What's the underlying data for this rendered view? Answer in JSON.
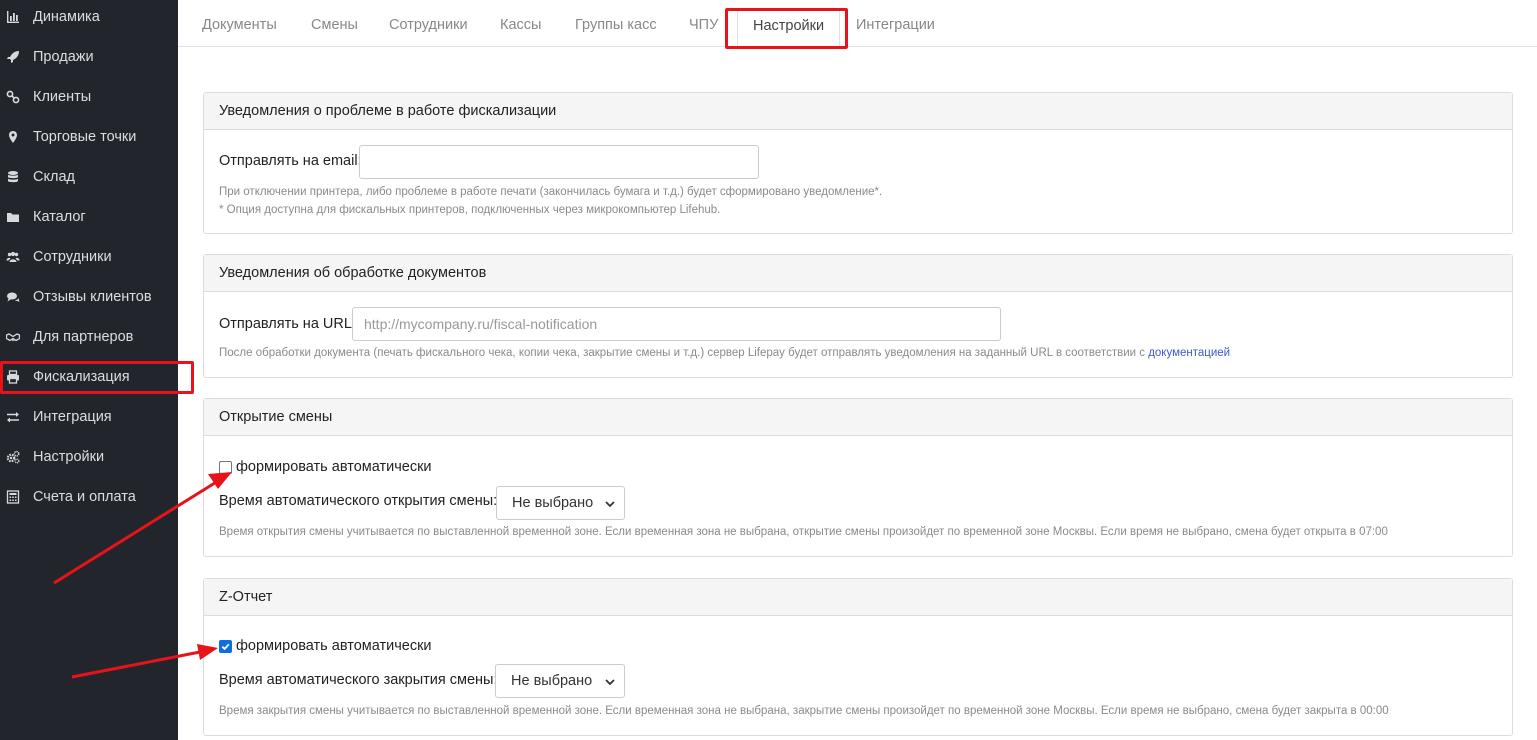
{
  "sidebar": {
    "items": [
      {
        "label": "Динамика",
        "icon": "bar-chart-icon"
      },
      {
        "label": "Продажи",
        "icon": "rocket-icon"
      },
      {
        "label": "Клиенты",
        "icon": "link-icon"
      },
      {
        "label": "Торговые точки",
        "icon": "map-pin-icon"
      },
      {
        "label": "Склад",
        "icon": "database-icon"
      },
      {
        "label": "Каталог",
        "icon": "folder-icon"
      },
      {
        "label": "Сотрудники",
        "icon": "users-icon"
      },
      {
        "label": "Отзывы клиентов",
        "icon": "comments-icon"
      },
      {
        "label": "Для партнеров",
        "icon": "handshake-icon"
      },
      {
        "label": "Фискализация",
        "icon": "printer-icon"
      },
      {
        "label": "Интеграция",
        "icon": "exchange-icon"
      },
      {
        "label": "Настройки",
        "icon": "gears-icon"
      },
      {
        "label": "Счета и оплата",
        "icon": "calculator-icon"
      }
    ],
    "active": "Фискализация"
  },
  "tabs": [
    "Документы",
    "Смены",
    "Сотрудники",
    "Кассы",
    "Группы касс",
    "ЧПУ",
    "Настройки",
    "Интеграции"
  ],
  "active_tab": "Настройки",
  "sections": {
    "fiscal_problem": {
      "title": "Уведомления о проблеме в работе фискализации",
      "email_label": "Отправлять на email:",
      "email_value": "",
      "help_line1": "При отключении принтера, либо проблеме в работе печати (закончилась бумага и т.д.) будет сформировано уведомление*.",
      "help_line2": "* Опция доступна для фискальных принтеров, подключенных через микрокомпьютер Lifehub."
    },
    "doc_processing": {
      "title": "Уведомления об обработке документов",
      "url_label": "Отправлять на URL:",
      "url_placeholder": "http://mycompany.ru/fiscal-notification",
      "help_text": "После обработки документа (печать фискального чека, копии чека, закрытие смены и т.д.) сервер Lifepay будет отправлять уведомления на заданный URL в соответствии с",
      "help_link": "документацией"
    },
    "shift_open": {
      "title": "Открытие смены",
      "checkbox_label": "формировать автоматически",
      "checked": false,
      "time_label": "Время автоматического открытия смены:",
      "time_value": "Не выбрано",
      "help_text": "Время открытия смены учитывается по выставленной временной зоне. Если временная зона не выбрана, открытие смены произойдет по временной зоне Москвы. Если время не выбрано, смена будет открыта в 07:00"
    },
    "z_report": {
      "title": "Z-Отчет",
      "checkbox_label": "формировать автоматически",
      "checked": true,
      "time_label": "Время автоматического закрытия смены:",
      "time_value": "Не выбрано",
      "help_text": "Время закрытия смены учитывается по выставленной временной зоне. Если временная зона не выбрана, закрытие смены произойдет по временной зоне Москвы. Если время не выбрано, смена будет закрыта в 00:00"
    }
  },
  "annotation_color": "#e8131a"
}
